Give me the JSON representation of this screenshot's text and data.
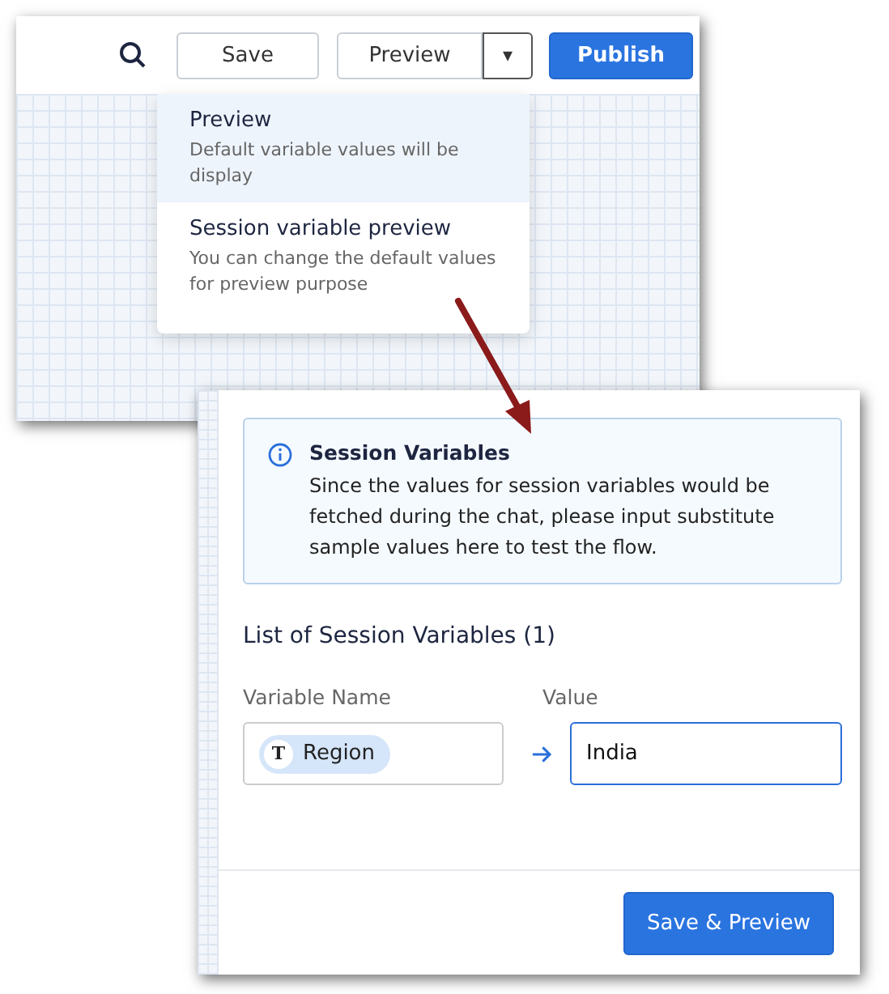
{
  "toolbar": {
    "save": "Save",
    "preview": "Preview",
    "caret": "▾",
    "publish": "Publish"
  },
  "preview_menu": [
    {
      "title": "Preview",
      "description": "Default variable values will be display",
      "selected": true
    },
    {
      "title": "Session variable preview",
      "description": "You can change the default values for preview purpose",
      "selected": false
    }
  ],
  "session_panel": {
    "info_title": "Session Variables",
    "info_text": "Since the values for session variables would be fetched during the chat, please input substitute sample values here to test the flow.",
    "list_heading": "List of Session Variables (1)",
    "columns": [
      "Variable Name",
      "Value"
    ],
    "variables": [
      {
        "type_badge": "T",
        "name": "Region",
        "value": "India"
      }
    ],
    "submit": "Save & Preview"
  }
}
